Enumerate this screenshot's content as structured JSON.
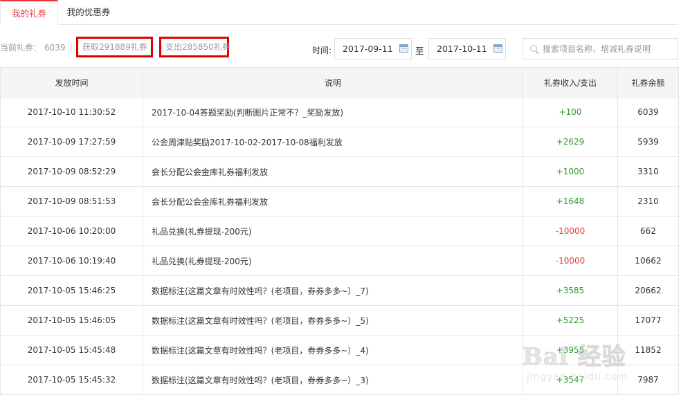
{
  "tabs": [
    {
      "label": "我的礼券",
      "active": true
    },
    {
      "label": "我的优惠券",
      "active": false
    }
  ],
  "balance": {
    "label": "当前礼券：",
    "value": "6039"
  },
  "stats": {
    "gain": "获取291889礼券",
    "spend": "支出285850礼券"
  },
  "filter": {
    "time_label": "时间:",
    "from": "2017-09-11",
    "to_label": "至",
    "to": "2017-10-11",
    "search_placeholder": "搜索项目名称，增减礼券说明"
  },
  "table": {
    "headers": [
      "发放时间",
      "说明",
      "礼券收入/支出",
      "礼券余额"
    ],
    "rows": [
      {
        "time": "2017-10-10 11:30:52",
        "desc": "2017-10-04答题奖励(判断图片正常不？_奖励发放)",
        "amount": "+100",
        "balance": "6039"
      },
      {
        "time": "2017-10-09 17:27:59",
        "desc": "公会周津贴奖励2017-10-02-2017-10-08福利发放",
        "amount": "+2629",
        "balance": "5939"
      },
      {
        "time": "2017-10-09 08:52:29",
        "desc": "会长分配公会金库礼券福利发放",
        "amount": "+1000",
        "balance": "3310"
      },
      {
        "time": "2017-10-09 08:51:53",
        "desc": "会长分配公会金库礼券福利发放",
        "amount": "+1648",
        "balance": "2310"
      },
      {
        "time": "2017-10-06 10:20:00",
        "desc": "礼品兑换(礼券提现-200元)",
        "amount": "-10000",
        "balance": "662"
      },
      {
        "time": "2017-10-06 10:19:40",
        "desc": "礼品兑换(礼券提现-200元)",
        "amount": "-10000",
        "balance": "10662"
      },
      {
        "time": "2017-10-05 15:46:25",
        "desc": "数据标注(这篇文章有时效性吗？(老项目，券券多多~）_7)",
        "amount": "+3585",
        "balance": "20662"
      },
      {
        "time": "2017-10-05 15:46:05",
        "desc": "数据标注(这篇文章有时效性吗？(老项目，券券多多~）_5)",
        "amount": "+5225",
        "balance": "17077"
      },
      {
        "time": "2017-10-05 15:45:48",
        "desc": "数据标注(这篇文章有时效性吗？(老项目，券券多多~）_4)",
        "amount": "+3955",
        "balance": "11852"
      },
      {
        "time": "2017-10-05 15:45:32",
        "desc": "数据标注(这篇文章有时效性吗？(老项目，券券多多~）_3)",
        "amount": "+3547",
        "balance": "7987"
      }
    ]
  },
  "watermark": {
    "text": "Bai 经验",
    "sub": "jingyan.baidu.com"
  },
  "colors": {
    "accent": "#e4393c",
    "positive": "#2f9a2f",
    "negative": "#e4393c",
    "highlight_box": "#e00000"
  }
}
